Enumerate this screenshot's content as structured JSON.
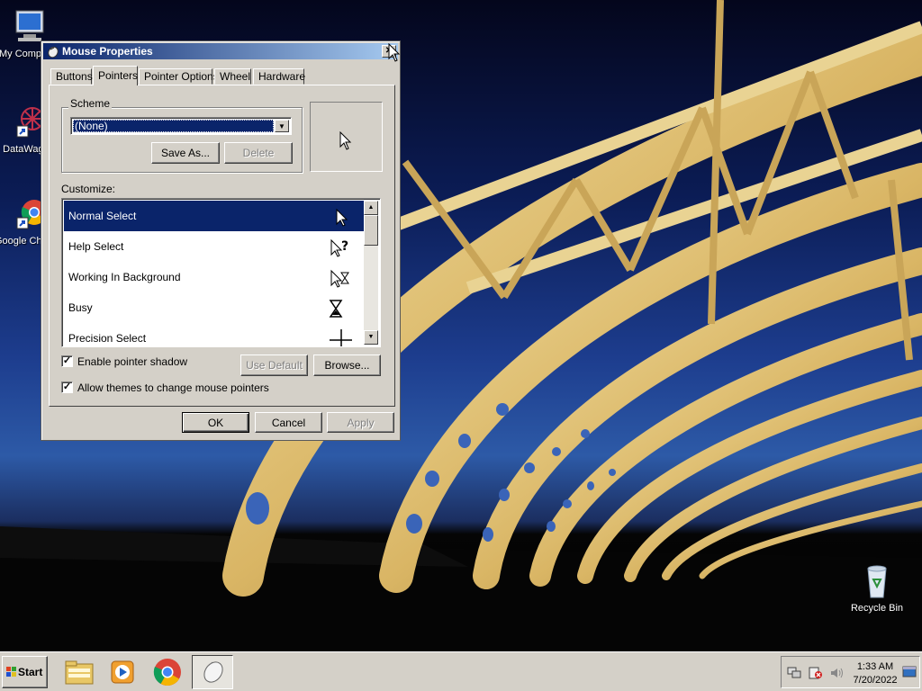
{
  "desktop": {
    "icons": [
      {
        "label": "My Computer",
        "icon": "computer-icon"
      },
      {
        "label": "DataWagon",
        "icon": "app-shortcut-icon"
      },
      {
        "label": "Google Chrome",
        "icon": "chrome-icon"
      },
      {
        "label": "Recycle Bin",
        "icon": "recycle-bin-icon"
      }
    ]
  },
  "dialog": {
    "title": "Mouse Properties",
    "close_glyph": "✕",
    "tabs": [
      {
        "label": "Buttons"
      },
      {
        "label": "Pointers",
        "active": true
      },
      {
        "label": "Pointer Options"
      },
      {
        "label": "Wheel"
      },
      {
        "label": "Hardware"
      }
    ],
    "scheme": {
      "group_label": "Scheme",
      "selected": "(None)",
      "save_as_label": "Save As...",
      "delete_label": "Delete"
    },
    "customize_label": "Customize:",
    "cursors": [
      {
        "label": "Normal Select",
        "icon": "arrow-cursor-icon",
        "selected": true
      },
      {
        "label": "Help Select",
        "icon": "help-cursor-icon"
      },
      {
        "label": "Working In Background",
        "icon": "working-cursor-icon"
      },
      {
        "label": "Busy",
        "icon": "hourglass-cursor-icon"
      },
      {
        "label": "Precision Select",
        "icon": "crosshair-cursor-icon"
      }
    ],
    "enable_shadow_label": "Enable pointer shadow",
    "enable_shadow_checked": true,
    "allow_themes_label": "Allow themes to change mouse pointers",
    "allow_themes_checked": true,
    "use_default_label": "Use Default",
    "browse_label": "Browse...",
    "ok_label": "OK",
    "cancel_label": "Cancel",
    "apply_label": "Apply"
  },
  "taskbar": {
    "start_label": "Start",
    "quick_launch": [
      "explorer-icon",
      "media-player-icon",
      "chrome-icon"
    ],
    "active_task_icon": "mouse-icon",
    "time": "1:33 AM",
    "date": "7/20/2022"
  },
  "colors": {
    "selection": "#0a246a",
    "dialog_face": "#d4d0c8"
  }
}
